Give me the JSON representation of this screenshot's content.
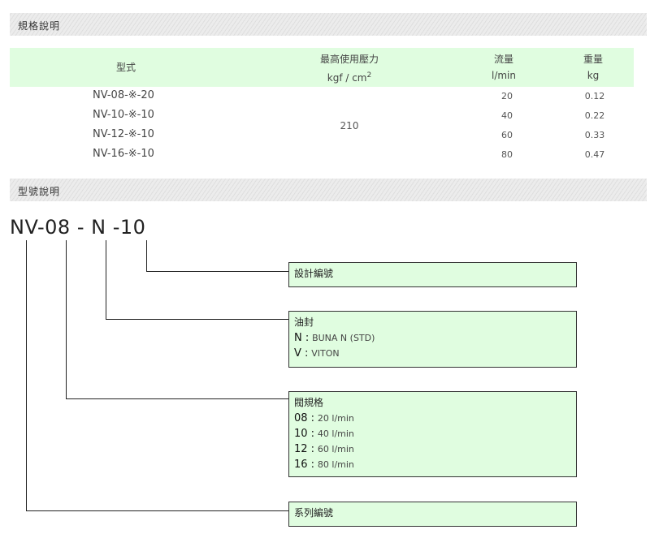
{
  "spec_section": {
    "title": "規格說明"
  },
  "spec_table": {
    "headers": {
      "model": "型式",
      "pressure_line1": "最高使用壓力",
      "pressure_unit": "kgf / cm",
      "pressure_sup": "2",
      "flow_line1": "流量",
      "flow_unit": "l/min",
      "weight_line1": "重量",
      "weight_unit": "kg"
    },
    "pressure_value": "210",
    "rows": [
      {
        "model": "NV-08-※-20",
        "flow": "20",
        "weight": "0.12"
      },
      {
        "model": "NV-10-※-10",
        "flow": "40",
        "weight": "0.22"
      },
      {
        "model": "NV-12-※-10",
        "flow": "60",
        "weight": "0.33"
      },
      {
        "model": "NV-16-※-10",
        "flow": "80",
        "weight": "0.47"
      }
    ]
  },
  "model_section": {
    "title": "型號說明"
  },
  "model_code": {
    "p1": "NV",
    "d1": "-",
    "p2": "08",
    "d2": "-",
    "p3": "N",
    "d3": "-",
    "p4": "10"
  },
  "boxes": {
    "design": {
      "title": "設計編號"
    },
    "seal": {
      "title": "油封",
      "items": [
        {
          "key": "N :",
          "value": "BUNA N (STD)"
        },
        {
          "key": "V :",
          "value": "VITON"
        }
      ]
    },
    "valve": {
      "title": "閥規格",
      "items": [
        {
          "key": "08 :",
          "value": "20 l/min"
        },
        {
          "key": "10 :",
          "value": "40 l/min"
        },
        {
          "key": "12 :",
          "value": "60 l/min"
        },
        {
          "key": "16 :",
          "value": "80 l/min"
        }
      ]
    },
    "series": {
      "title": "系列編號"
    }
  }
}
